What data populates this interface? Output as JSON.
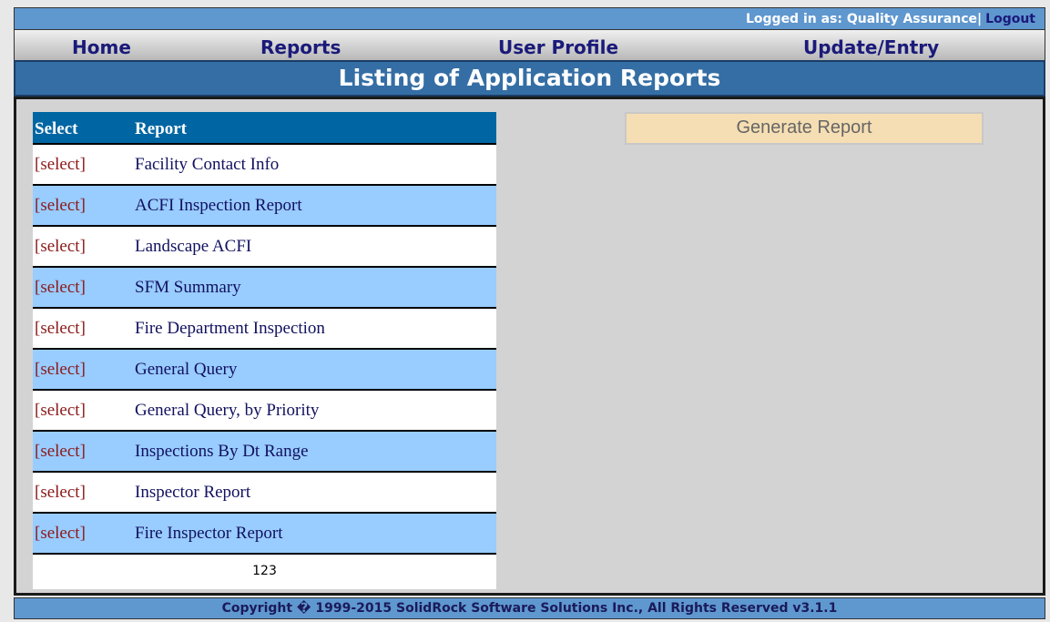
{
  "topbar": {
    "logged_in_label": "Logged in as: Quality Assurance|",
    "logout_label": "Logout"
  },
  "nav": {
    "home": "Home",
    "reports": "Reports",
    "user_profile": "User Profile",
    "update_entry": "Update/Entry"
  },
  "page_title": "Listing of Application Reports",
  "table": {
    "headers": {
      "select": "Select",
      "report": "Report"
    },
    "rows": [
      {
        "select": "[select]",
        "name": "Facility Contact Info"
      },
      {
        "select": "[select]",
        "name": "ACFI Inspection Report"
      },
      {
        "select": "[select]",
        "name": "Landscape ACFI"
      },
      {
        "select": "[select]",
        "name": "SFM Summary"
      },
      {
        "select": "[select]",
        "name": "Fire Department Inspection"
      },
      {
        "select": "[select]",
        "name": "General Query"
      },
      {
        "select": "[select]",
        "name": "General Query, by Priority"
      },
      {
        "select": "[select]",
        "name": "Inspections By Dt Range"
      },
      {
        "select": "[select]",
        "name": "Inspector Report"
      },
      {
        "select": "[select]",
        "name": "Fire Inspector Report"
      }
    ],
    "pager": [
      "1",
      "2",
      "3"
    ]
  },
  "generate_button": "Generate Report",
  "footer": "Copyright � 1999-2015 SolidRock Software Solutions Inc., All Rights Reserved v3.1.1",
  "colors": {
    "topbar": "#5f97cf",
    "title_bar": "#346ea4",
    "table_header": "#0066a3",
    "row_alt": "#99ccff",
    "select_link": "#8b1a1a",
    "report_text": "#111160",
    "button": "#f5deb3"
  }
}
